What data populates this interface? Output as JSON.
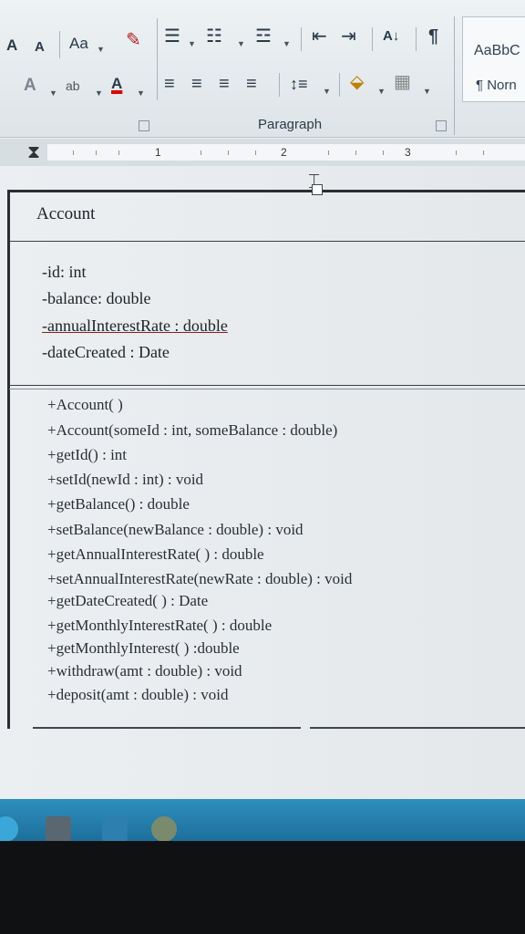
{
  "ribbon": {
    "font_size_up": "A",
    "font_size_down": "A",
    "change_case": "Aa",
    "text_effects": "A",
    "highlight": "ab",
    "font_color": "A",
    "sort": "A↓",
    "pilcrow": "¶",
    "group_label": "Paragraph",
    "style_sample": "AaBbC",
    "style_normal": "¶ Norn"
  },
  "ruler": {
    "numbers": [
      "1",
      "2",
      "3"
    ]
  },
  "uml": {
    "class_name": "Account",
    "attributes": [
      "-id: int",
      "-balance: double",
      "-annualInterestRate : double",
      "-dateCreated : Date"
    ],
    "methods": [
      "+Account( )",
      "+Account(someId : int, someBalance : double)",
      "+getId() : int",
      "+setId(newId : int) : void",
      "+getBalance() : double",
      "+setBalance(newBalance : double) : void",
      "+getAnnualInterestRate( ) : double",
      "+setAnnualInterestRate(newRate : double) : void",
      "+getDateCreated( ) : Date",
      "+getMonthlyInterestRate( ) : double",
      "+getMonthlyInterest( ) :double",
      "+withdraw(amt : double) : void",
      "+deposit(amt : double) : void"
    ]
  },
  "colors": {
    "ribbon": "#e6ecef",
    "taskbar": "#2481b0",
    "underline": "#8a1f1f"
  }
}
